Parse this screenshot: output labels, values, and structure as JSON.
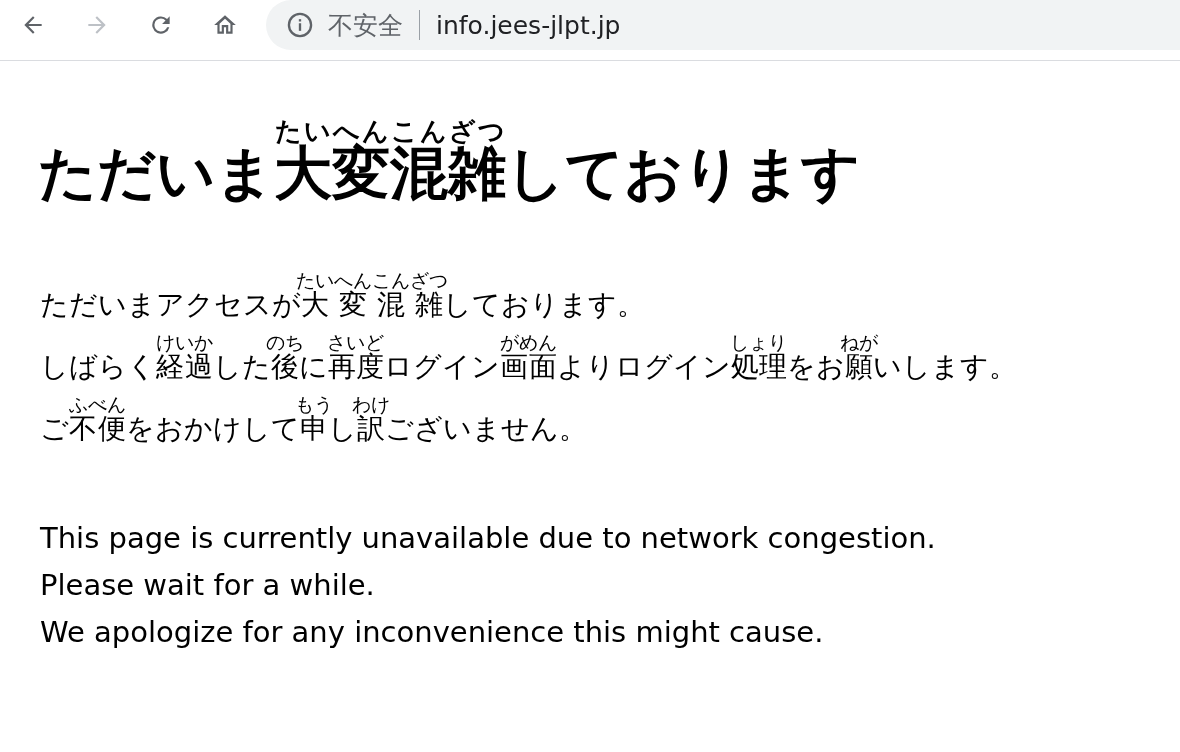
{
  "toolbar": {
    "nav_buttons": [
      {
        "kind": "back",
        "disabled": false
      },
      {
        "kind": "forward",
        "disabled": true
      },
      {
        "kind": "reload",
        "disabled": false
      },
      {
        "kind": "home",
        "disabled": false
      }
    ],
    "address_bar": {
      "security_label": "不安全",
      "url": "info.jees-jlpt.jp"
    }
  },
  "heading": [
    {
      "text": "ただいま"
    },
    {
      "text": "大変混雑",
      "ruby": "たいへんこんざつ"
    },
    {
      "text": "しております"
    }
  ],
  "japanese_lines": [
    [
      {
        "text": "ただいまアクセスが"
      },
      {
        "text": "大",
        "ruby": "たい"
      },
      {
        "text": "変",
        "ruby": "へん"
      },
      {
        "text": "混",
        "ruby": "こん"
      },
      {
        "text": "雑",
        "ruby": "ざつ"
      },
      {
        "text": "しております。"
      }
    ],
    [
      {
        "text": "しばらく"
      },
      {
        "text": "経過",
        "ruby": "けいか"
      },
      {
        "text": "した"
      },
      {
        "text": "後",
        "ruby": "のち"
      },
      {
        "text": "に"
      },
      {
        "text": "再度",
        "ruby": "さいど"
      },
      {
        "text": "ログイン"
      },
      {
        "text": "画面",
        "ruby": "がめん"
      },
      {
        "text": "よりログイン"
      },
      {
        "text": "処理",
        "ruby": "しょり"
      },
      {
        "text": "をお"
      },
      {
        "text": "願",
        "ruby": "ねが"
      },
      {
        "text": "いします。"
      }
    ],
    [
      {
        "text": "ご"
      },
      {
        "text": "不便",
        "ruby": "ふべん"
      },
      {
        "text": "をおかけして"
      },
      {
        "text": "申",
        "ruby": "もう"
      },
      {
        "text": "し"
      },
      {
        "text": "訳",
        "ruby": "わけ"
      },
      {
        "text": "ございません。"
      }
    ]
  ],
  "english_lines": [
    "This page is currently unavailable due to network congestion.",
    "Please wait for a while.",
    "We apologize for any inconvenience this might cause."
  ]
}
